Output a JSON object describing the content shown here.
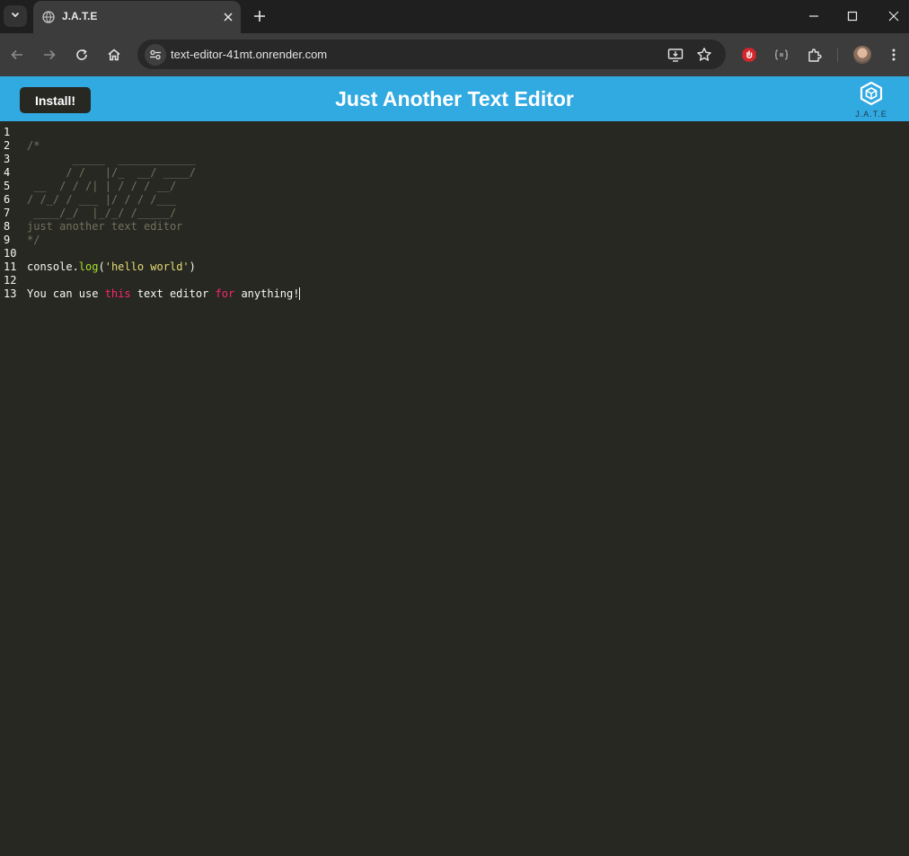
{
  "browser": {
    "tab": {
      "title": "J.A.T.E"
    },
    "url": "text-editor-41mt.onrender.com"
  },
  "colors": {
    "header_bg": "#31a9e1",
    "editor_bg": "#272822",
    "comment": "#75715e",
    "function": "#a6e22e",
    "string": "#e6db74",
    "keyword": "#f92672",
    "text": "#f8f8f2"
  },
  "header": {
    "install_label": "Install!",
    "title": "Just Another Text Editor",
    "logo_text": "J.A.T.E",
    "logo_icon": "cube-logo-icon"
  },
  "editor": {
    "lines": [
      {
        "number": "1",
        "tokens": []
      },
      {
        "number": "2",
        "tokens": [
          {
            "type": "comment",
            "text": "/*"
          }
        ]
      },
      {
        "number": "3",
        "tokens": [
          {
            "type": "comment",
            "text": "       _____  ____________"
          }
        ]
      },
      {
        "number": "4",
        "tokens": [
          {
            "type": "comment",
            "text": "      / /   |/_  __/ ____/"
          }
        ]
      },
      {
        "number": "5",
        "tokens": [
          {
            "type": "comment",
            "text": " __  / / /| | / / / __/"
          }
        ]
      },
      {
        "number": "6",
        "tokens": [
          {
            "type": "comment",
            "text": "/ /_/ / ___ |/ / / /___"
          }
        ]
      },
      {
        "number": "7",
        "tokens": [
          {
            "type": "comment",
            "text": " ____/_/  |_/_/ /_____/"
          }
        ]
      },
      {
        "number": "8",
        "tokens": [
          {
            "type": "comment",
            "text": "just another text editor"
          }
        ]
      },
      {
        "number": "9",
        "tokens": [
          {
            "type": "comment",
            "text": "*/"
          }
        ]
      },
      {
        "number": "10",
        "tokens": []
      },
      {
        "number": "11",
        "tokens": [
          {
            "type": "plain",
            "text": "console."
          },
          {
            "type": "fn",
            "text": "log"
          },
          {
            "type": "plain",
            "text": "("
          },
          {
            "type": "str",
            "text": "'hello world'"
          },
          {
            "type": "plain",
            "text": ")"
          }
        ]
      },
      {
        "number": "12",
        "tokens": []
      },
      {
        "number": "13",
        "tokens": [
          {
            "type": "plain",
            "text": "You can use "
          },
          {
            "type": "kw",
            "text": "this"
          },
          {
            "type": "plain",
            "text": " text editor "
          },
          {
            "type": "kw",
            "text": "for"
          },
          {
            "type": "plain",
            "text": " anything!"
          }
        ],
        "cursor": true
      }
    ]
  }
}
